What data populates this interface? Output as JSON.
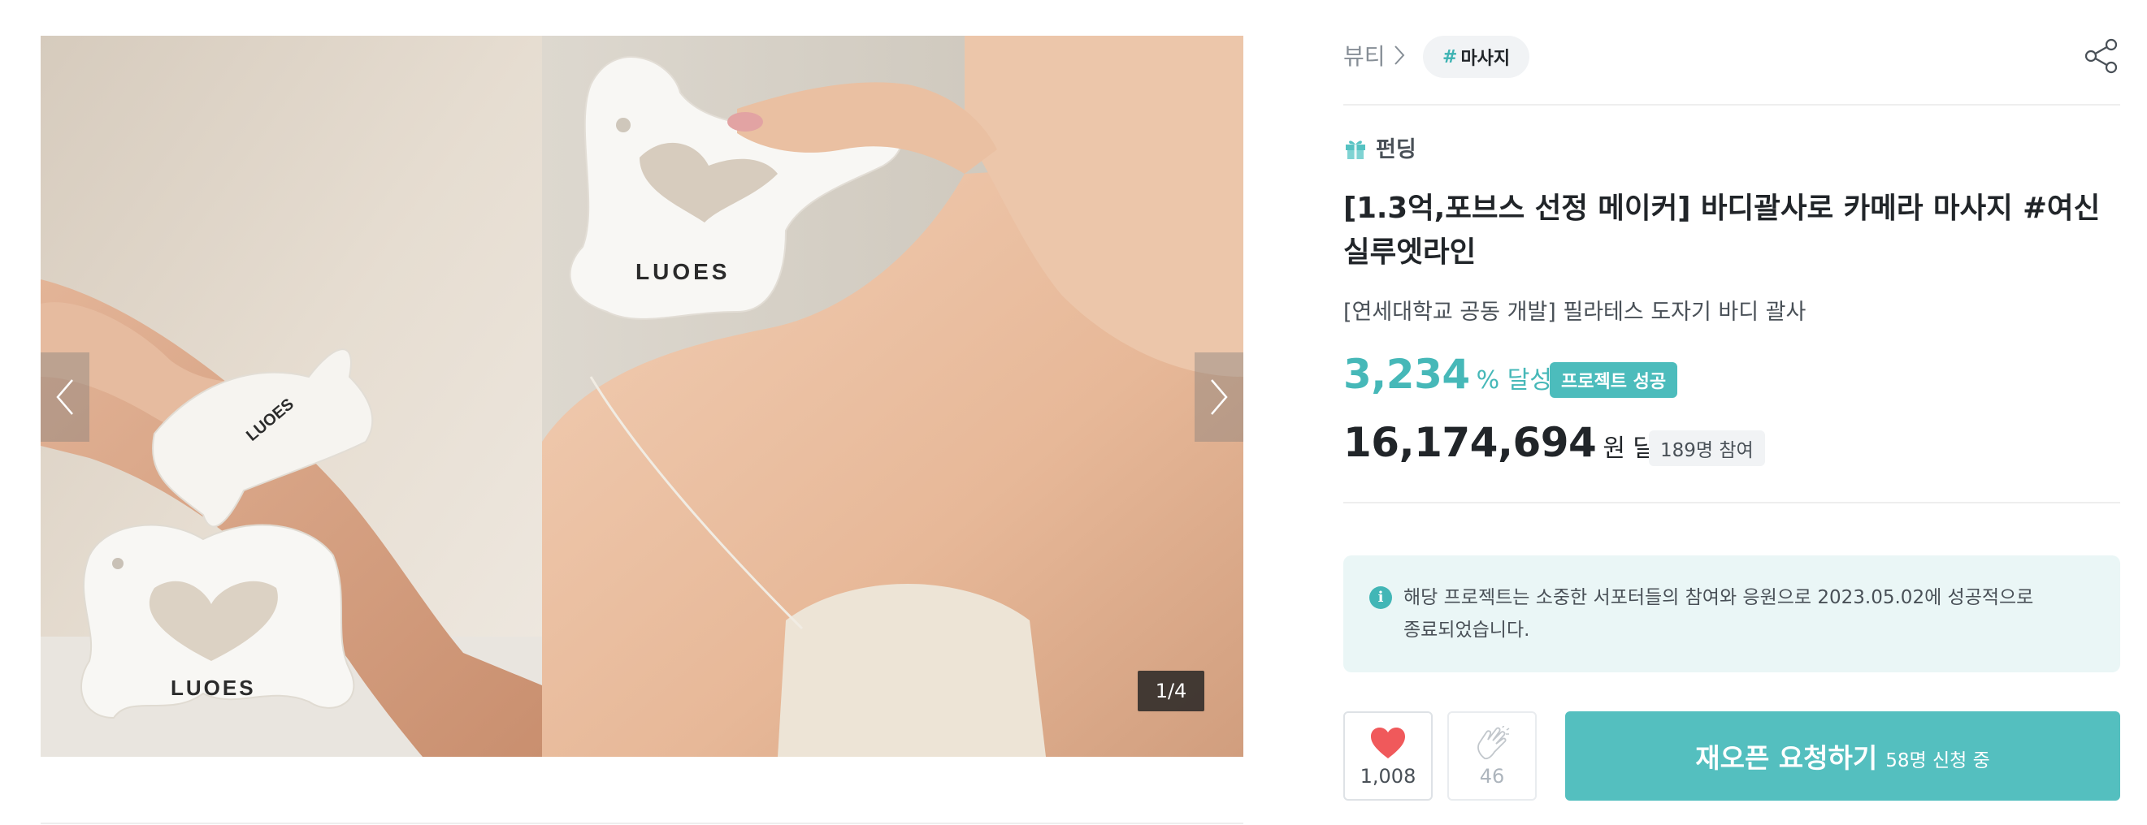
{
  "gallery": {
    "left_logo_text": "LUOES",
    "right_logo_text": "LUOES",
    "counter": "1/4",
    "prev_icon": "chevron-left-icon",
    "next_icon": "chevron-right-icon"
  },
  "breadcrumb": {
    "category": "뷰티",
    "tag_hash": "#",
    "tag_label": "마사지"
  },
  "share_icon": "share-icon",
  "project": {
    "category_icon": "gift-icon",
    "category_label": "펀딩",
    "title": "[1.3억,포브스 선정 메이커] 바디괄사로 카메라 마사지 #여신실루엣라인",
    "subtitle": "[연세대학교 공동 개발] 필라테스 도자기 바디 괄사",
    "achievement_rate": "3,234",
    "achievement_unit": "% 달성",
    "status_badge": "프로젝트 성공",
    "amount": "16,174,694",
    "amount_unit": "원 달성",
    "supporters": "189명 참여"
  },
  "notice": {
    "icon": "info-icon",
    "line1": "해당 프로젝트는 소중한 서포터들의 참여와 응원으로 2023.05.02에 성공적으로",
    "line2": "종료되었습니다."
  },
  "actions": {
    "like_icon": "heart-icon",
    "like_count": "1,008",
    "cheer_icon": "clap-icon",
    "cheer_count": "46",
    "reopen_label": "재오픈 요청하기",
    "reopen_count": "58명 신청 중"
  },
  "colors": {
    "accent": "#54bfbf",
    "accent_text": "#46b8b8",
    "notice_bg": "#eaf6f6",
    "like_red": "#f0595b"
  }
}
